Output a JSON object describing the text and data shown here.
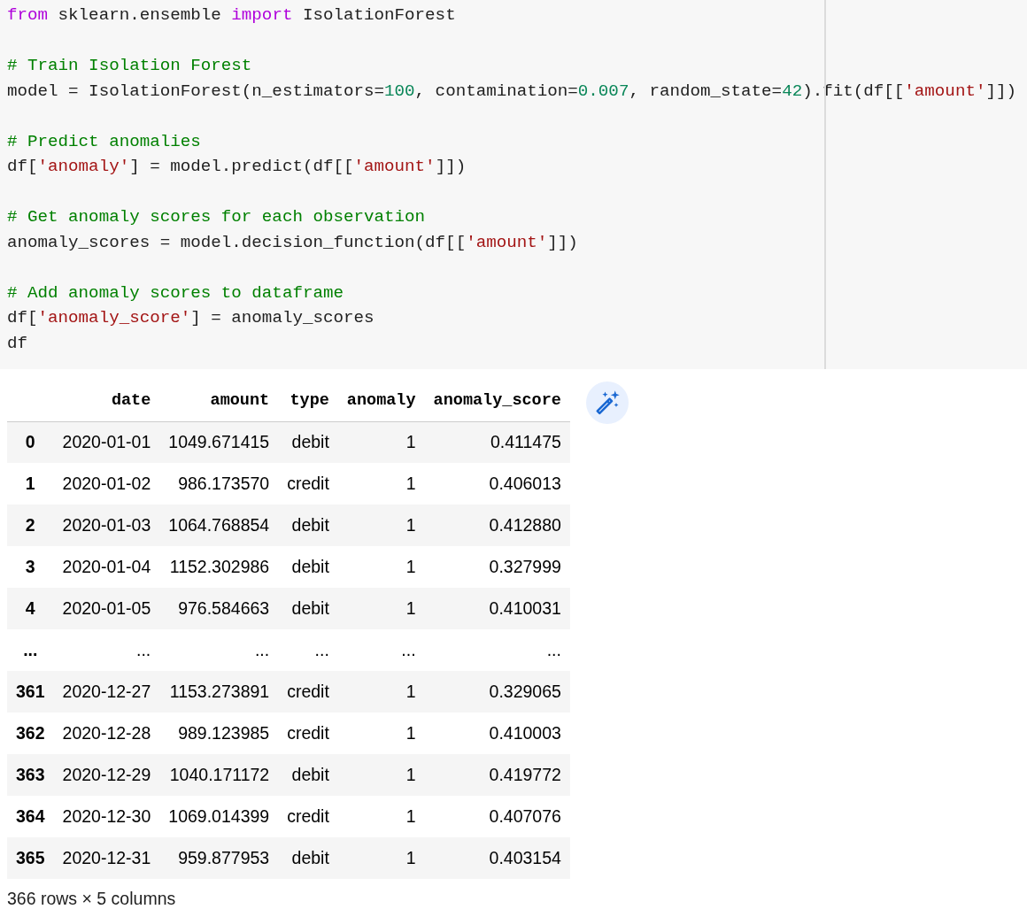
{
  "code_cell": {
    "blocks": [
      {
        "lines": [
          [
            {
              "kind": "keyword",
              "text": "from"
            },
            {
              "kind": "plain",
              "text": " sklearn.ensemble "
            },
            {
              "kind": "keyword",
              "text": "import"
            },
            {
              "kind": "plain",
              "text": " IsolationForest"
            }
          ]
        ]
      },
      {
        "lines": [
          [
            {
              "kind": "comment",
              "text": "# Train Isolation Forest"
            }
          ],
          [
            {
              "kind": "plain",
              "text": "model = IsolationForest(n_estimators="
            },
            {
              "kind": "number",
              "text": "100"
            },
            {
              "kind": "plain",
              "text": ", contamination="
            },
            {
              "kind": "number",
              "text": "0.007"
            },
            {
              "kind": "plain",
              "text": ", random_state="
            },
            {
              "kind": "number",
              "text": "42"
            },
            {
              "kind": "plain",
              "text": ").fit(df[["
            },
            {
              "kind": "string",
              "text": "'amount'"
            },
            {
              "kind": "plain",
              "text": "]])"
            }
          ]
        ]
      },
      {
        "lines": [
          [
            {
              "kind": "comment",
              "text": "# Predict anomalies"
            }
          ],
          [
            {
              "kind": "plain",
              "text": "df["
            },
            {
              "kind": "string",
              "text": "'anomaly'"
            },
            {
              "kind": "plain",
              "text": "] = model.predict(df[["
            },
            {
              "kind": "string",
              "text": "'amount'"
            },
            {
              "kind": "plain",
              "text": "]])"
            }
          ]
        ]
      },
      {
        "lines": [
          [
            {
              "kind": "comment",
              "text": "# Get anomaly scores for each observation"
            }
          ],
          [
            {
              "kind": "plain",
              "text": "anomaly_scores = model.decision_function(df[["
            },
            {
              "kind": "string",
              "text": "'amount'"
            },
            {
              "kind": "plain",
              "text": "]])"
            }
          ]
        ]
      },
      {
        "lines": [
          [
            {
              "kind": "comment",
              "text": "# Add anomaly scores to dataframe"
            }
          ],
          [
            {
              "kind": "plain",
              "text": "df["
            },
            {
              "kind": "string",
              "text": "'anomaly_score'"
            },
            {
              "kind": "plain",
              "text": "] = anomaly_scores"
            }
          ],
          [
            {
              "kind": "plain",
              "text": "df"
            }
          ]
        ]
      }
    ]
  },
  "output_table": {
    "columns": [
      "date",
      "amount",
      "type",
      "anomaly",
      "anomaly_score"
    ],
    "rows": [
      {
        "index": "0",
        "cells": [
          "2020-01-01",
          "1049.671415",
          "debit",
          "1",
          "0.411475"
        ]
      },
      {
        "index": "1",
        "cells": [
          "2020-01-02",
          "986.173570",
          "credit",
          "1",
          "0.406013"
        ]
      },
      {
        "index": "2",
        "cells": [
          "2020-01-03",
          "1064.768854",
          "debit",
          "1",
          "0.412880"
        ]
      },
      {
        "index": "3",
        "cells": [
          "2020-01-04",
          "1152.302986",
          "debit",
          "1",
          "0.327999"
        ]
      },
      {
        "index": "4",
        "cells": [
          "2020-01-05",
          "976.584663",
          "debit",
          "1",
          "0.410031"
        ]
      },
      {
        "index": "...",
        "cells": [
          "...",
          "...",
          "...",
          "...",
          "..."
        ]
      },
      {
        "index": "361",
        "cells": [
          "2020-12-27",
          "1153.273891",
          "credit",
          "1",
          "0.329065"
        ]
      },
      {
        "index": "362",
        "cells": [
          "2020-12-28",
          "989.123985",
          "credit",
          "1",
          "0.410003"
        ]
      },
      {
        "index": "363",
        "cells": [
          "2020-12-29",
          "1040.171172",
          "debit",
          "1",
          "0.419772"
        ]
      },
      {
        "index": "364",
        "cells": [
          "2020-12-30",
          "1069.014399",
          "credit",
          "1",
          "0.407076"
        ]
      },
      {
        "index": "365",
        "cells": [
          "2020-12-31",
          "959.877953",
          "debit",
          "1",
          "0.403154"
        ]
      }
    ],
    "shape_note": "366 rows × 5 columns"
  }
}
